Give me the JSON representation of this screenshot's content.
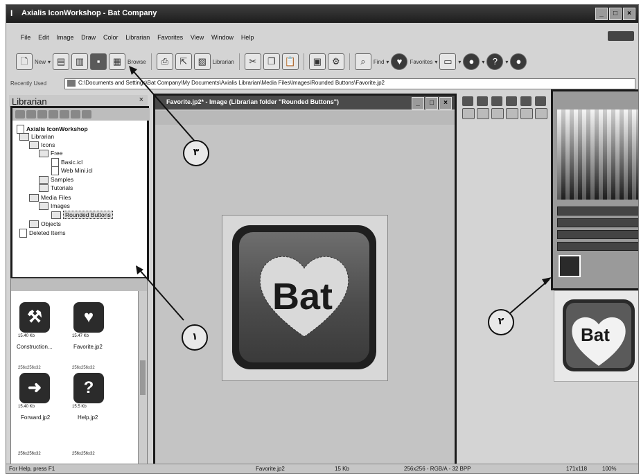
{
  "window": {
    "title": "Axialis IconWorkshop - Bat Company"
  },
  "menu": [
    "File",
    "Edit",
    "Image",
    "Draw",
    "Color",
    "Librarian",
    "Favorites",
    "View",
    "Window",
    "Help"
  ],
  "toolbar": {
    "new_label": "New",
    "browse_label": "Browse",
    "librarian_label": "Librarian",
    "find_label": "Find",
    "favorites_label": "Favorites"
  },
  "address": {
    "recently_label": "Recently Used",
    "path": "C:\\Documents and Settings\\Bat Company\\My Documents\\Axialis Librarian\\Media Files\\Images\\Rounded Buttons\\Favorite.jp2"
  },
  "librarian": {
    "title": "Librarian",
    "tree": [
      {
        "label": "Axialis IconWorkshop",
        "level": 0
      },
      {
        "label": "Librarian",
        "level": 1
      },
      {
        "label": "Icons",
        "level": 2
      },
      {
        "label": "Free",
        "level": 3
      },
      {
        "label": "Basic.icl",
        "level": 4
      },
      {
        "label": "Web Mini.icl",
        "level": 4
      },
      {
        "label": "Samples",
        "level": 3
      },
      {
        "label": "Tutorials",
        "level": 3
      },
      {
        "label": "Media Files",
        "level": 2
      },
      {
        "label": "Images",
        "level": 3
      },
      {
        "label": "Rounded Buttons",
        "level": 4
      },
      {
        "label": "Objects",
        "level": 2
      },
      {
        "label": "Deleted Items",
        "level": 1
      }
    ],
    "thumbnails": [
      {
        "name": "Construction...",
        "size": "15.40 Kb",
        "dims": ""
      },
      {
        "name": "Favorite.jp2",
        "size": "15.47 Kb",
        "dims": ""
      },
      {
        "name": "Forward.jp2",
        "size": "15.40 Kb",
        "dims": "256x256x32"
      },
      {
        "name": "Help.jp2",
        "size": "15.5 Kb",
        "dims": "256x256x32"
      }
    ],
    "more_dims": [
      "256x256x32",
      "256x256x32"
    ]
  },
  "document": {
    "title": "Favorite.jp2* - Image (Librarian folder \"Rounded Buttons\")",
    "canvas_text": "Bat"
  },
  "preview": {
    "text": "Bat"
  },
  "status": {
    "help": "For Help, press F1",
    "file": "Favorite.jp2",
    "size": "15 Kb",
    "format": "256x256 - RGB/A - 32 BPP",
    "coords": "171x118",
    "zoom": "100%"
  },
  "callouts": [
    "٣",
    "١",
    "٢"
  ]
}
